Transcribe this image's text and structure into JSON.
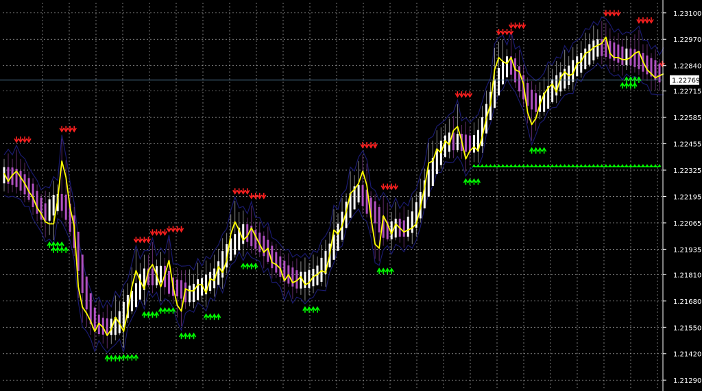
{
  "chart_data": {
    "type": "line",
    "title": "",
    "xlabel": "",
    "ylabel": "",
    "ylim": [
      1.2125,
      1.2315
    ],
    "y_ticks": [
      "1.23100",
      "1.22970",
      "1.22840",
      "1.22715",
      "1.22585",
      "1.22455",
      "1.22325",
      "1.22195",
      "1.22065",
      "1.21935",
      "1.21810",
      "1.21680",
      "1.21550",
      "1.21420",
      "1.21290"
    ],
    "current_price": "1.22769",
    "grid": true,
    "colors": {
      "background": "#000000",
      "grid": "#c8c8c8",
      "signal_line": "#ffff00",
      "bull_bar": "#ffffff",
      "bear_bar": "#b050c0",
      "channel": "#1a1a6e",
      "buy_arrow": "#00ff00",
      "sell_arrow": "#ff2020",
      "support_line": "#00ff00",
      "current_price_line": "#4a6e8a"
    },
    "x": [
      0,
      1,
      2,
      3,
      4,
      5,
      6,
      7,
      8,
      9,
      10,
      11,
      12,
      13,
      14,
      15,
      16,
      17,
      18,
      19,
      20,
      21,
      22,
      23,
      24,
      25,
      26,
      27,
      28,
      29,
      30,
      31,
      32,
      33,
      34,
      35,
      36,
      37,
      38,
      39,
      40,
      41,
      42,
      43,
      44,
      45,
      46,
      47,
      48,
      49,
      50,
      51,
      52,
      53,
      54,
      55,
      56,
      57,
      58,
      59,
      60,
      61,
      62,
      63,
      64,
      65,
      66,
      67,
      68,
      69,
      70,
      71,
      72,
      73,
      74,
      75,
      76,
      77,
      78,
      79,
      80,
      81,
      82,
      83,
      84,
      85,
      86,
      87,
      88,
      89,
      90,
      91,
      92,
      93,
      94,
      95,
      96,
      97,
      98,
      99,
      100,
      101,
      102,
      103,
      104,
      105,
      106,
      107,
      108,
      109,
      110,
      111,
      112,
      113,
      114,
      115,
      116,
      117,
      118,
      119,
      120,
      121,
      122,
      123,
      124,
      125,
      126,
      127,
      128,
      129,
      130,
      131,
      132,
      133,
      134,
      135,
      136,
      137,
      138,
      139,
      140,
      141,
      142,
      143,
      144,
      145,
      146,
      147,
      148,
      149,
      150,
      151,
      152,
      153,
      154,
      155,
      156,
      157,
      158,
      159
    ],
    "series": [
      {
        "values": [
          1.2231,
          1.2227,
          1.223,
          1.2232,
          1.2229,
          1.2226,
          1.2222,
          1.2219,
          1.2214,
          1.2211,
          1.2207,
          1.2206,
          1.2206,
          1.2218,
          1.2237,
          1.2229,
          1.2214,
          1.2205,
          1.2175,
          1.2165,
          1.2162,
          1.2158,
          1.2153,
          1.2157,
          1.2155,
          1.2151,
          1.2154,
          1.216,
          1.2157,
          1.2153,
          1.2163,
          1.2175,
          1.2183,
          1.2178,
          1.2174,
          1.2183,
          1.2186,
          1.2181,
          1.2175,
          1.2181,
          1.2188,
          1.2175,
          1.2166,
          1.2163,
          1.2174,
          1.2173,
          1.2173,
          1.2176,
          1.2176,
          1.2172,
          1.2179,
          1.2178,
          1.2185,
          1.2182,
          1.2188,
          1.2201,
          1.2207,
          1.2203,
          1.2198,
          1.22,
          1.2204,
          1.22,
          1.2196,
          1.2192,
          1.2194,
          1.2187,
          1.2186,
          1.2184,
          1.2178,
          1.2181,
          1.2177,
          1.2178,
          1.218,
          1.2176,
          1.2177,
          1.218,
          1.2181,
          1.2183,
          1.2182,
          1.2191,
          1.2203,
          1.2201,
          1.2205,
          1.2212,
          1.2221,
          1.2223,
          1.2226,
          1.2232,
          1.2225,
          1.2209,
          1.2196,
          1.2194,
          1.221,
          1.2206,
          1.2201,
          1.2206,
          1.2204,
          1.2202,
          1.2203,
          1.2204,
          1.2206,
          1.2214,
          1.2224,
          1.2236,
          1.2237,
          1.2243,
          1.2241,
          1.2247,
          1.2245,
          1.2252,
          1.2254,
          1.2247,
          1.2238,
          1.2242,
          1.2244,
          1.2242,
          1.2249,
          1.2258,
          1.2265,
          1.2282,
          1.2288,
          1.2286,
          1.2285,
          1.2288,
          1.2282,
          1.2281,
          1.2275,
          1.2261,
          1.2255,
          1.2258,
          1.2265,
          1.227,
          1.2273,
          1.2275,
          1.2271,
          1.2278,
          1.2281,
          1.2279,
          1.228,
          1.2285,
          1.2286,
          1.229,
          1.2291,
          1.2293,
          1.2294,
          1.2295,
          1.2298,
          1.229,
          1.2288,
          1.2288,
          1.2287,
          1.2287,
          1.2288,
          1.229,
          1.2291,
          1.2286,
          1.2282,
          1.228,
          1.2278,
          1.2279,
          1.228
        ]
      }
    ]
  }
}
